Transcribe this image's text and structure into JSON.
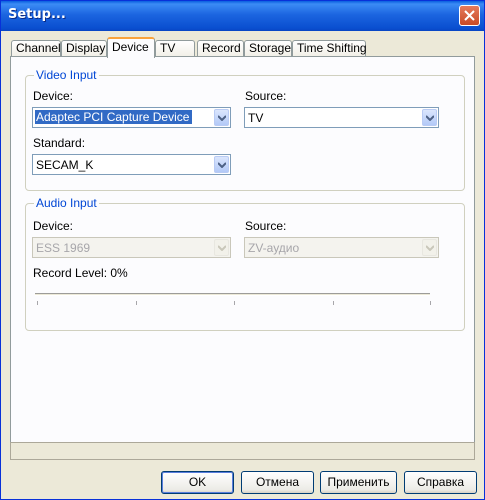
{
  "window": {
    "title": "Setup..."
  },
  "tabs": [
    {
      "label": "Channel"
    },
    {
      "label": "Display"
    },
    {
      "label": "Device"
    },
    {
      "label": "TV"
    },
    {
      "label": "Record"
    },
    {
      "label": "Storage"
    },
    {
      "label": "Time Shifting"
    }
  ],
  "active_tab": "Device",
  "video_input": {
    "group_title": "Video Input",
    "device_label": "Device:",
    "device_value": "Adaptec PCI Capture Device",
    "source_label": "Source:",
    "source_value": "TV",
    "standard_label": "Standard:",
    "standard_value": "SECAM_K"
  },
  "audio_input": {
    "group_title": "Audio Input",
    "device_label": "Device:",
    "device_value": "ESS 1969",
    "source_label": "Source:",
    "source_value": "ZV-аудио",
    "record_level_label": "Record Level: 0%",
    "record_level": 0
  },
  "buttons": {
    "ok": "OK",
    "cancel": "Отмена",
    "apply": "Применить",
    "help": "Справка"
  },
  "colors": {
    "titlebar": "#0a4fd0",
    "accent_tab": "#f9a33c",
    "group_title": "#0046d5",
    "selection": "#316ac5"
  }
}
